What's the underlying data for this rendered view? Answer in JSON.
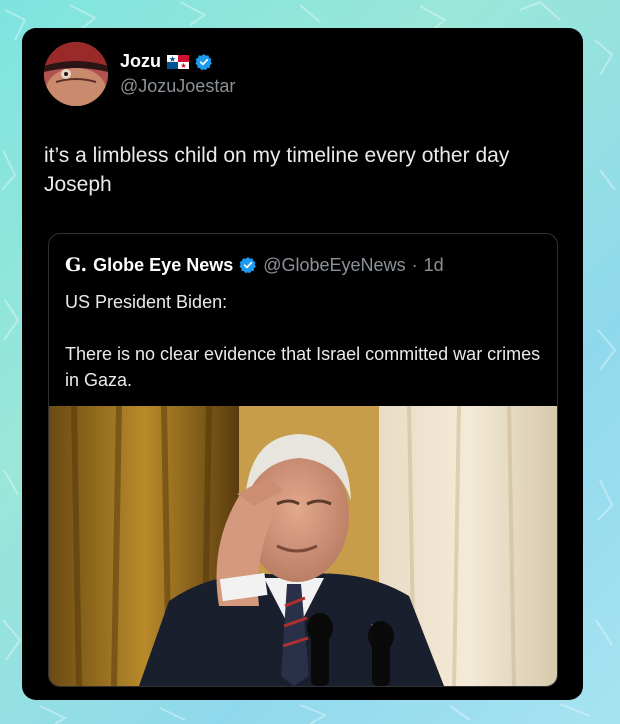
{
  "tweet": {
    "display_name": "Jozu",
    "handle": "@JozuJoestar",
    "text": "it’s a limbless child on my timeline every other day Joseph",
    "flag_icon": "panama-flag-icon",
    "verified_icon": "verified-badge-icon",
    "colors": {
      "background": "#000000",
      "text": "#e9eaeb",
      "secondary_text": "#8b9197",
      "verified_blue": "#1d9bf0"
    }
  },
  "quote": {
    "logo": "G.",
    "display_name": "Globe Eye News",
    "handle": "@GlobeEyeNews",
    "separator": "·",
    "time": "1d",
    "line1": "US President Biden:",
    "line2": "There is no clear evidence that Israel committed war crimes in Gaza.",
    "verified_icon": "verified-badge-icon"
  }
}
